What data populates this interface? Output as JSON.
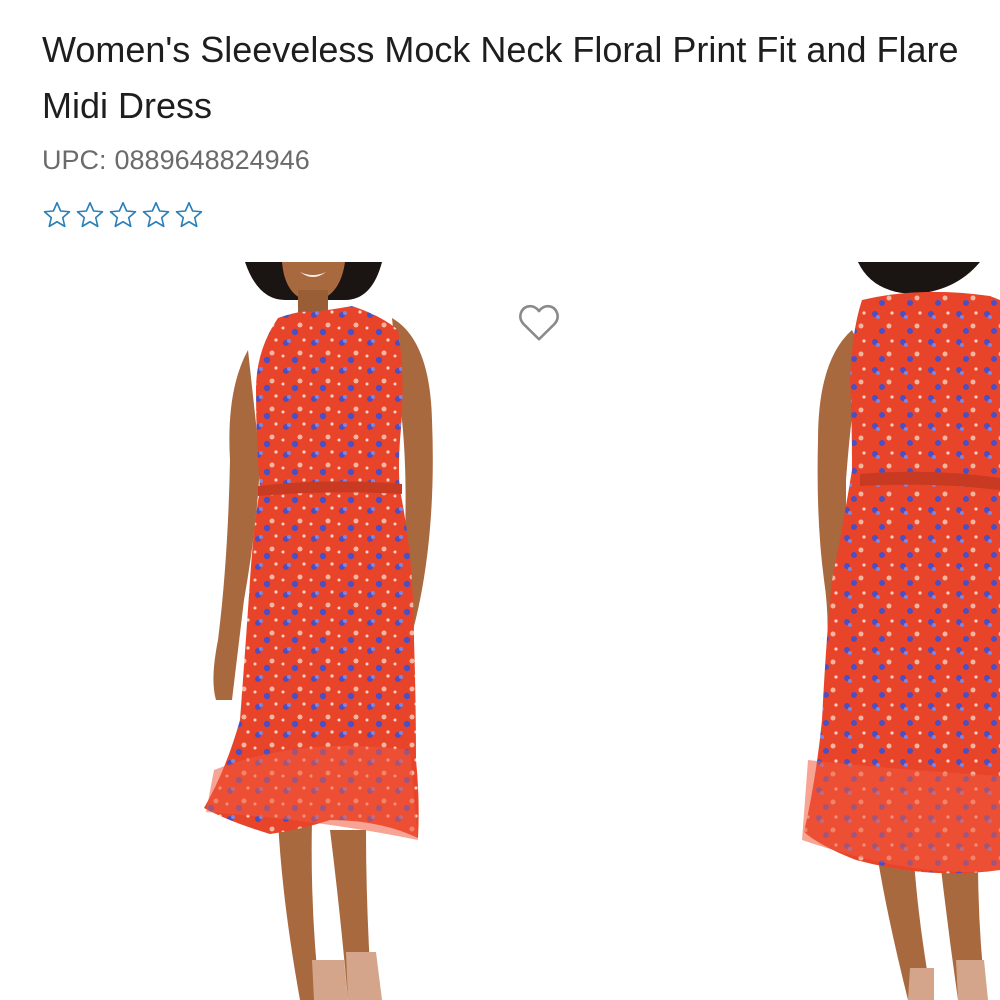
{
  "product": {
    "title": "Women's Sleeveless Mock Neck Floral Print Fit and Flare Midi Dress",
    "upc_label": "UPC:",
    "upc_value": "0889648824946",
    "rating": {
      "value": 0,
      "max": 5,
      "icon": "star-outline-icon",
      "color": "#2b7fb8"
    }
  },
  "gallery": {
    "images": [
      {
        "view": "front",
        "description": "model wearing red floral print sleeveless midi dress"
      },
      {
        "view": "back",
        "description": "back view of red floral print sleeveless midi dress"
      }
    ],
    "favorite_icon": "heart-outline-icon"
  },
  "colors": {
    "dress_red": "#e8442a",
    "floral_blue": "#4b4fc4",
    "skin": "#a9693f",
    "hair": "#1a1412",
    "text": "#1e1e1e",
    "muted_text": "#6b6b6b"
  }
}
